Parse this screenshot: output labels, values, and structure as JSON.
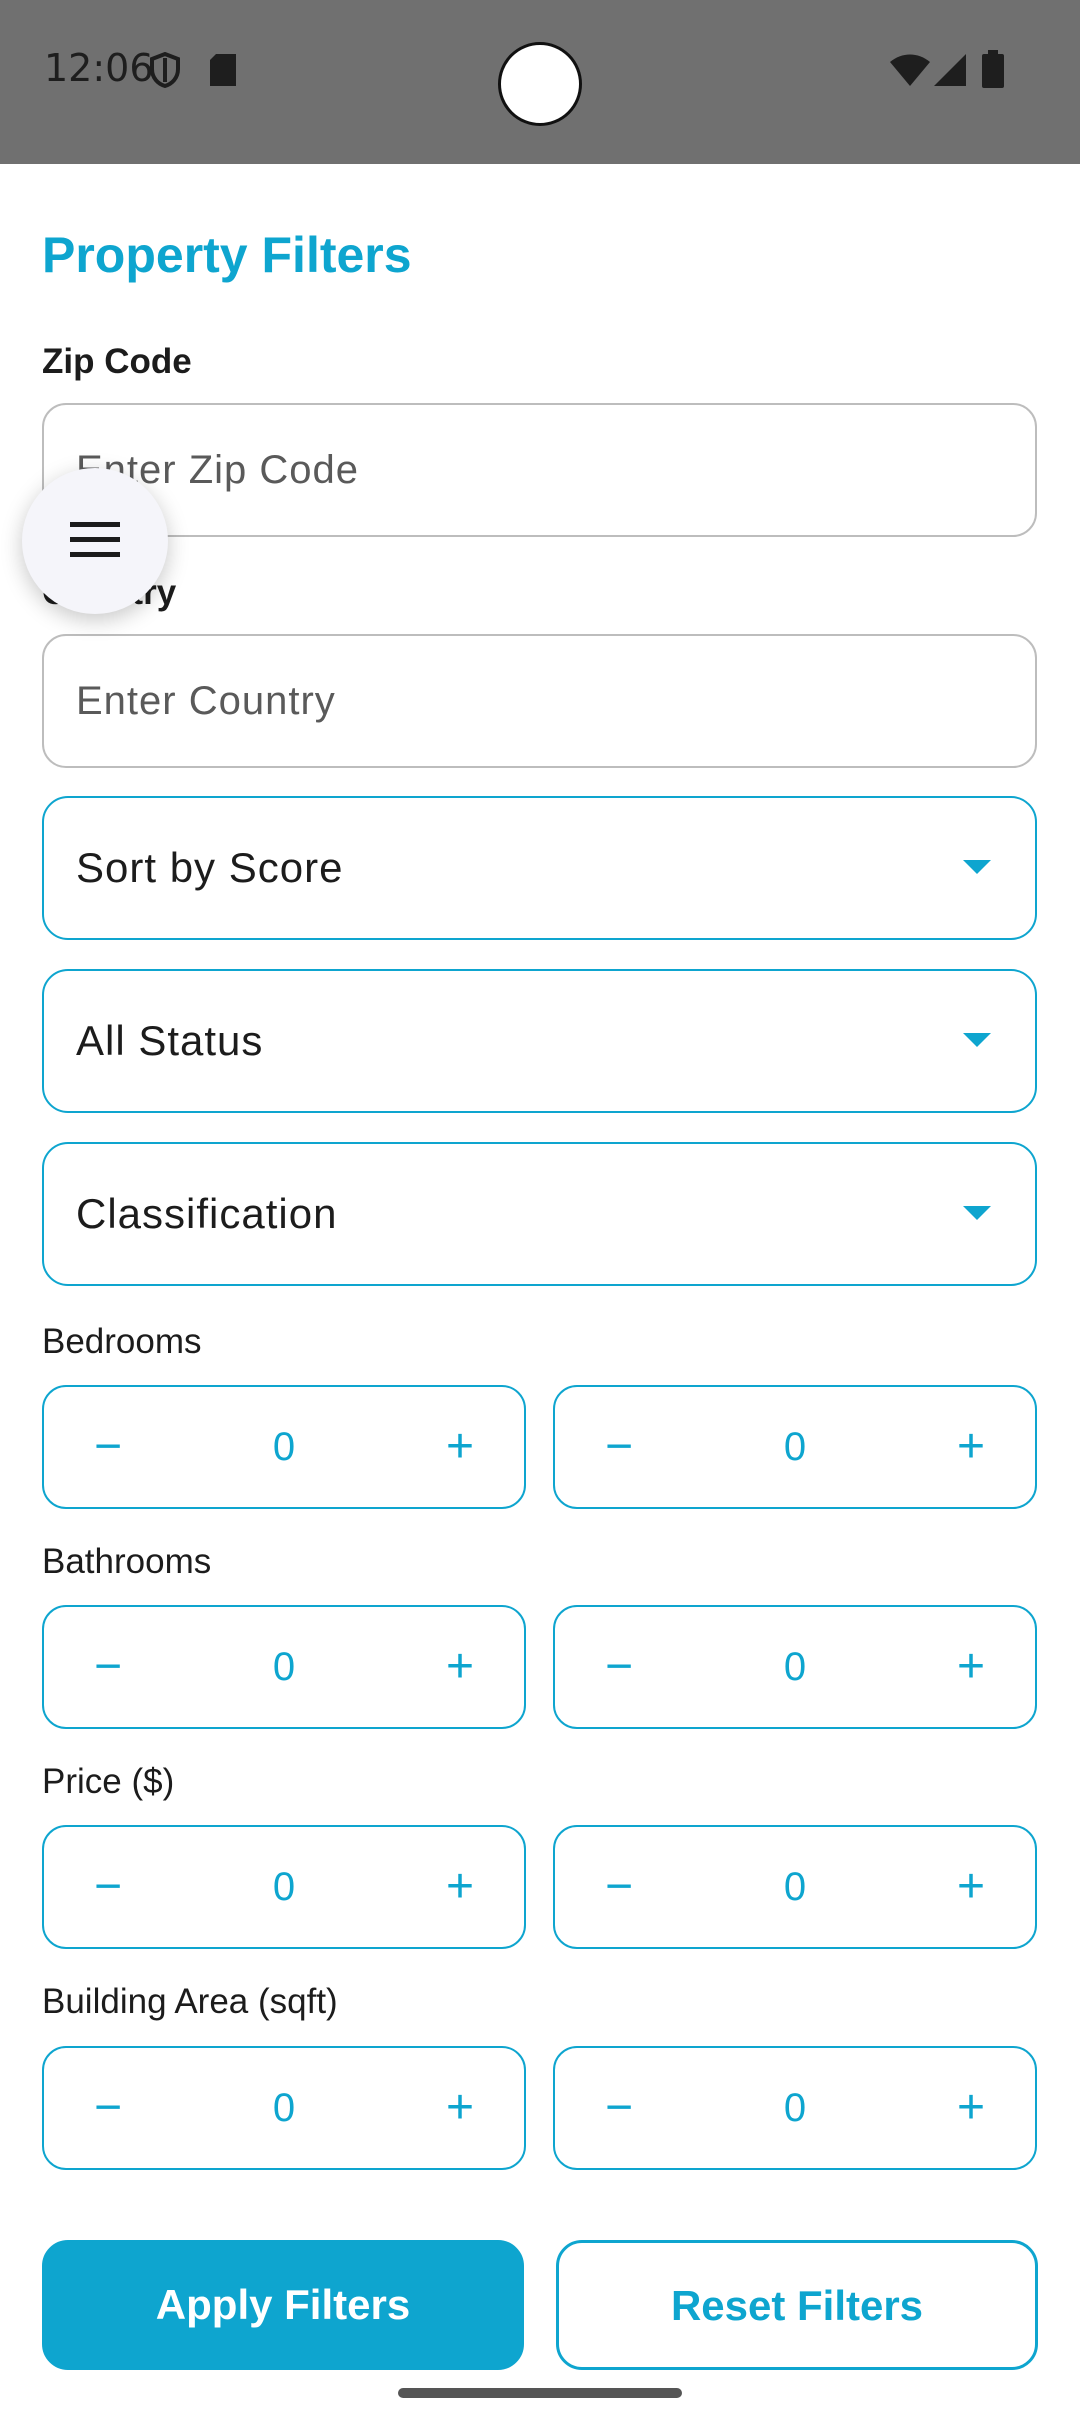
{
  "status_bar": {
    "time": "12:06",
    "icons": [
      "shield-icon",
      "sd-card-icon",
      "wifi-icon",
      "signal-icon",
      "battery-icon"
    ]
  },
  "page": {
    "title": "Property Filters"
  },
  "zip": {
    "label": "Zip Code",
    "placeholder": "Enter Zip Code"
  },
  "country": {
    "label": "Country",
    "placeholder": "Enter Country"
  },
  "dropdowns": {
    "sort": "Sort by Score",
    "status": "All Status",
    "classification": "Classification"
  },
  "bedrooms": {
    "label": "Bedrooms",
    "min": "0",
    "max": "0"
  },
  "bathrooms": {
    "label": "Bathrooms",
    "min": "0",
    "max": "0"
  },
  "price": {
    "label": "Price ($)",
    "min": "0",
    "max": "0"
  },
  "area": {
    "label": "Building Area (sqft)",
    "min": "0",
    "max": "0"
  },
  "stepper": {
    "minus": "−",
    "plus": "+"
  },
  "actions": {
    "apply": "Apply Filters",
    "reset": "Reset Filters"
  },
  "colors": {
    "accent": "#0ea5cf",
    "status_bar": "#707070"
  }
}
